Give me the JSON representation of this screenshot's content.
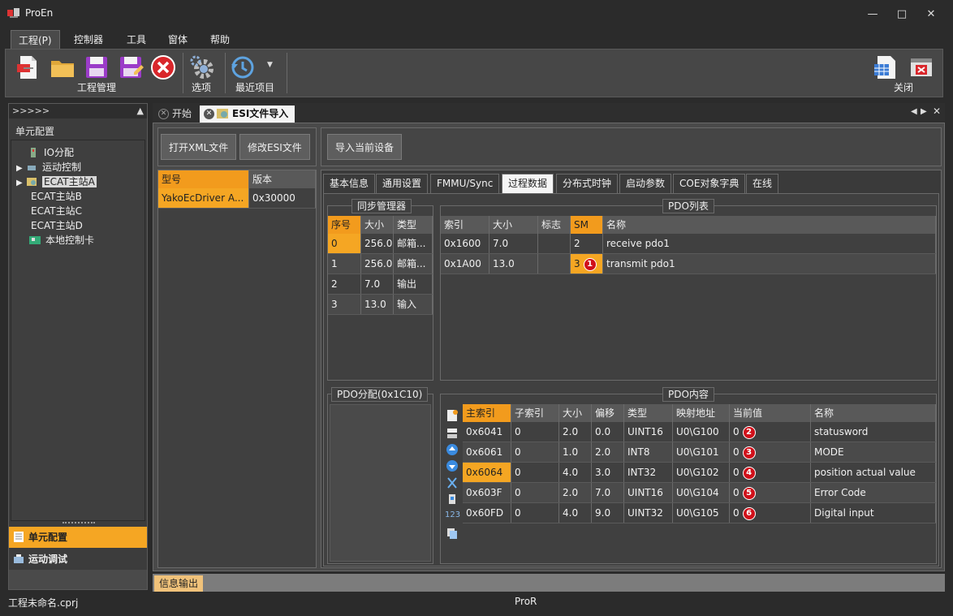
{
  "window": {
    "title": "ProEn"
  },
  "menu": [
    "工程(P)",
    "控制器",
    "工具",
    "窗体",
    "帮助"
  ],
  "ribbon": {
    "group_project": "工程管理",
    "options": "选项",
    "recent": "最近项目",
    "close": "关闭"
  },
  "left_panel": {
    "header": ">>>>>",
    "title": "单元配置",
    "tree": [
      "IO分配",
      "运动控制",
      "ECAT主站A",
      "ECAT主站B",
      "ECAT主站C",
      "ECAT主站D",
      "本地控制卡"
    ],
    "tab_unit": "单元配置",
    "tab_debug": "运动调试"
  },
  "doc_tabs": {
    "start": "开始",
    "esi_import": "ESI文件导入"
  },
  "buttons": {
    "open_xml": "打开XML文件",
    "edit_esi": "修改ESI文件",
    "import_device": "导入当前设备"
  },
  "device_table": {
    "headers": [
      "型号",
      "版本"
    ],
    "rows": [
      [
        "YakoEcDriver A...",
        "0x30000"
      ]
    ]
  },
  "subtabs": [
    "基本信息",
    "通用设置",
    "FMMU/Sync",
    "过程数据",
    "分布式时钟",
    "启动参数",
    "COE对象字典",
    "在线"
  ],
  "sync_manager": {
    "title": "同步管理器",
    "headers": [
      "序号",
      "大小",
      "类型"
    ],
    "rows": [
      [
        "0",
        "256.0",
        "邮箱..."
      ],
      [
        "1",
        "256.0",
        "邮箱..."
      ],
      [
        "2",
        "7.0",
        "输出"
      ],
      [
        "3",
        "13.0",
        "输入"
      ]
    ]
  },
  "pdo_list": {
    "title": "PDO列表",
    "headers": [
      "索引",
      "大小",
      "标志",
      "SM",
      "名称"
    ],
    "rows": [
      [
        "0x1600",
        "7.0",
        "",
        "2",
        "receive pdo1"
      ],
      [
        "0x1A00",
        "13.0",
        "",
        "3",
        "transmit pdo1"
      ]
    ],
    "badge": "1"
  },
  "pdo_assign": {
    "title": "PDO分配(0x1C10)"
  },
  "pdo_content": {
    "title": "PDO内容",
    "headers": [
      "主索引",
      "子索引",
      "大小",
      "偏移",
      "类型",
      "映射地址",
      "当前值",
      "名称"
    ],
    "rows": [
      [
        "0x6041",
        "0",
        "2.0",
        "0.0",
        "UINT16",
        "U0\\G100",
        "0",
        "statusword",
        "2"
      ],
      [
        "0x6061",
        "0",
        "1.0",
        "2.0",
        "INT8",
        "U0\\G101",
        "0",
        "MODE",
        "3"
      ],
      [
        "0x6064",
        "0",
        "4.0",
        "3.0",
        "INT32",
        "U0\\G102",
        "0",
        "position actual value",
        "4"
      ],
      [
        "0x603F",
        "0",
        "2.0",
        "7.0",
        "UINT16",
        "U0\\G104",
        "0",
        "Error Code",
        "5"
      ],
      [
        "0x60FD",
        "0",
        "4.0",
        "9.0",
        "UINT32",
        "U0\\G105",
        "0",
        "Digital input",
        "6"
      ]
    ]
  },
  "info_tab": "信息输出",
  "status": {
    "project": "工程未命名.cprj",
    "center": "ProR"
  }
}
